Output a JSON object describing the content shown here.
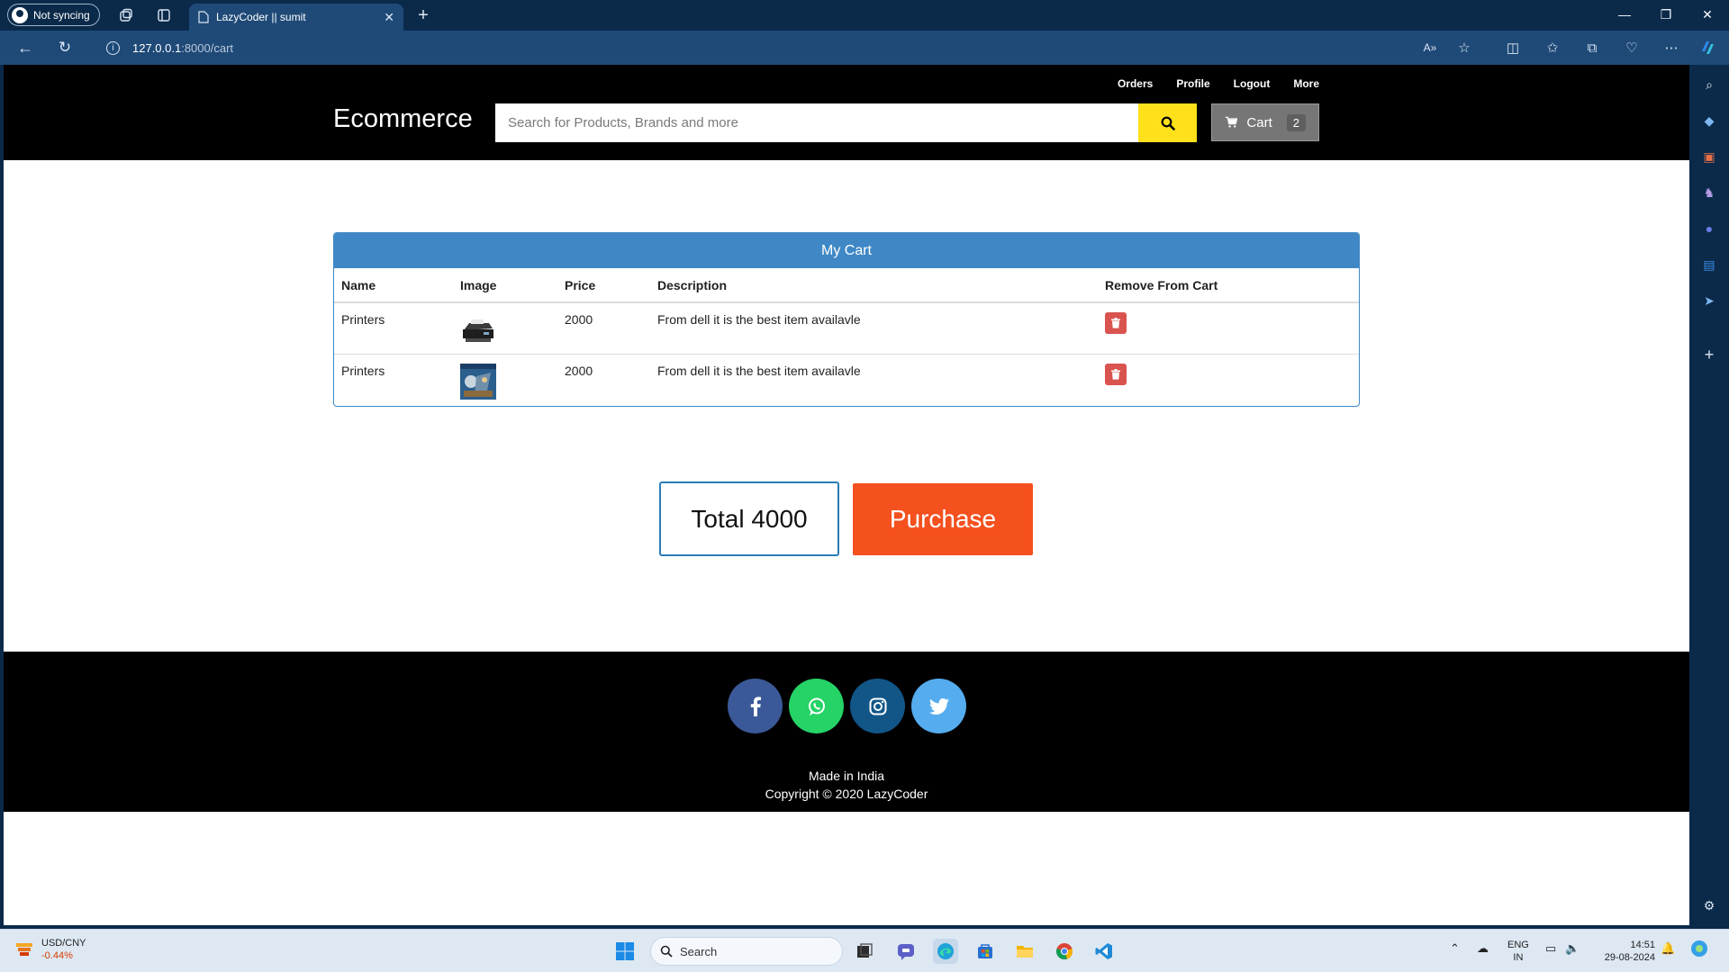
{
  "browser": {
    "profile_label": "Not syncing",
    "tab_title": "LazyCoder || sumit",
    "url_host": "127.0.0.1",
    "url_rest": ":8000/cart"
  },
  "header": {
    "links": [
      "Orders",
      "Profile",
      "Logout",
      "More"
    ],
    "brand": "Ecommerce",
    "search_placeholder": "Search for Products, Brands and more",
    "cart_label": "Cart",
    "cart_count": "2"
  },
  "cart": {
    "title": "My Cart",
    "columns": [
      "Name",
      "Image",
      "Price",
      "Description",
      "Remove From Cart"
    ],
    "rows": [
      {
        "name": "Printers",
        "price": "2000",
        "description": "From dell it is the best item availavle",
        "image": "printer-thumbnail"
      },
      {
        "name": "Printers",
        "price": "2000",
        "description": "From dell it is the best item availavle",
        "image": "game-cover-thumbnail"
      }
    ]
  },
  "summary": {
    "total_label": "Total 4000",
    "purchase_label": "Purchase"
  },
  "footer": {
    "social": [
      {
        "name": "facebook",
        "color": "#3b5998"
      },
      {
        "name": "whatsapp",
        "color": "#25d366"
      },
      {
        "name": "instagram",
        "color": "#125688"
      },
      {
        "name": "twitter",
        "color": "#55acee"
      }
    ],
    "made_in": "Made in India",
    "copyright": "Copyright © 2020 LazyCoder"
  },
  "taskbar": {
    "widget_title": "USD/CNY",
    "widget_change": "-0.44%",
    "search_label": "Search",
    "lang_top": "ENG",
    "lang_bottom": "IN",
    "time": "14:51",
    "date": "29-08-2024"
  },
  "colors": {
    "accent_blue": "#3f88c5",
    "search_yellow": "#ffe11b",
    "purchase_orange": "#f4511e",
    "delete_red": "#d9534f"
  }
}
